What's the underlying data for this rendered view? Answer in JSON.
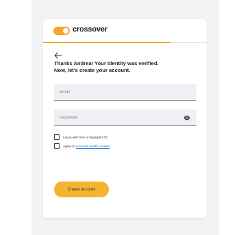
{
  "brand": {
    "name": "crossover",
    "accent_color": "#f5a623"
  },
  "progress": {
    "fraction": 0.78
  },
  "form": {
    "heading_line1": "Thanks Andrea! Your identity was verified.",
    "heading_line2": "Now, let's create your account.",
    "email_placeholder": "Email",
    "password_placeholder": "Password",
    "checkbox_biometric_label": "Log in with face or fingerprint ID",
    "checkbox_consent_prefix": "Agree to ",
    "checkbox_consent_link": "universal health consent",
    "submit_label": "Create account"
  },
  "icons": {
    "back": "arrow-left-icon",
    "password_visibility": "eye-icon"
  }
}
